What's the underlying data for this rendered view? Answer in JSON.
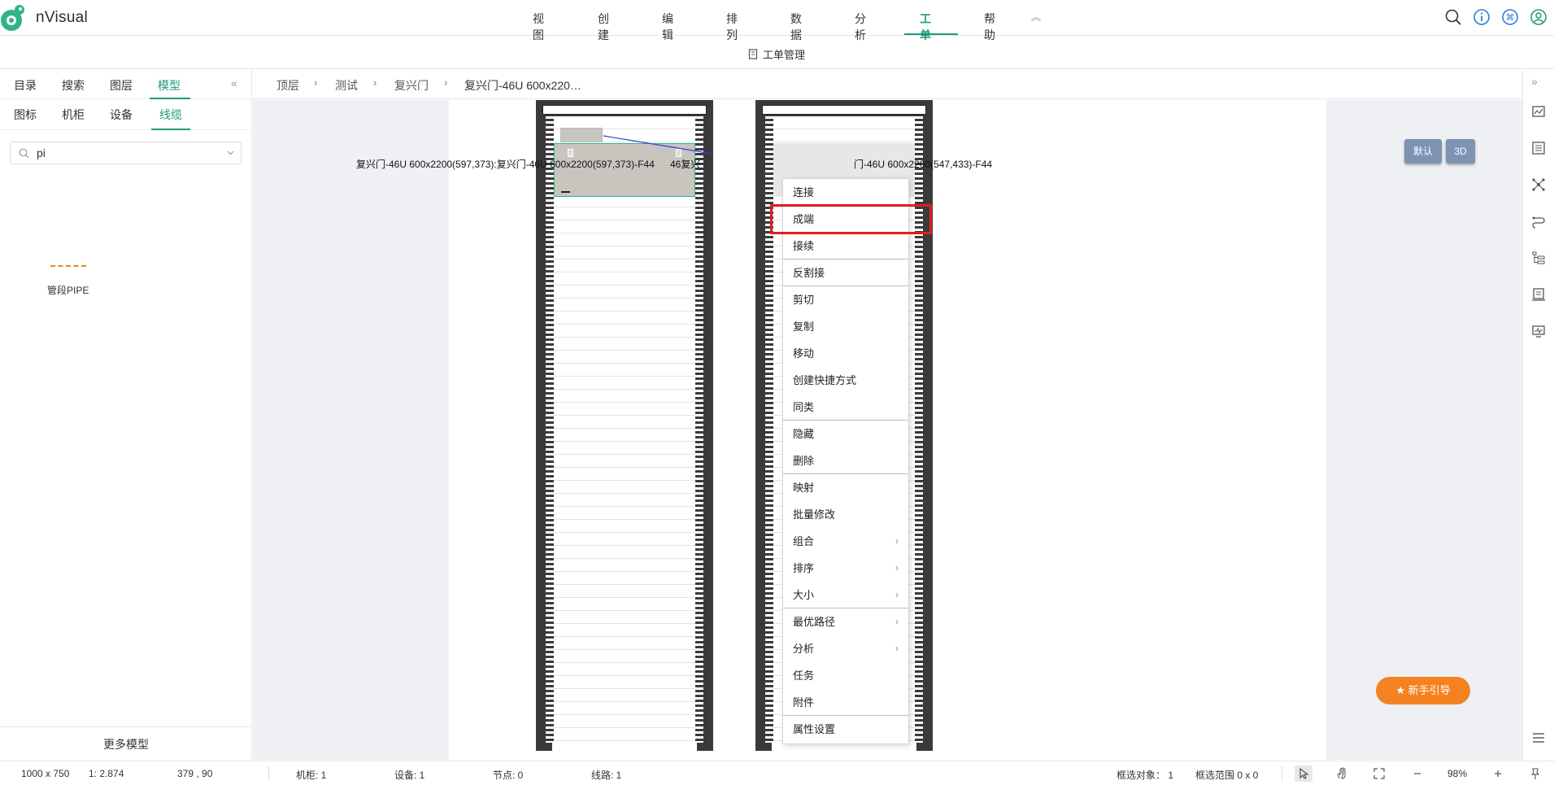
{
  "app": {
    "name": "nVisual"
  },
  "top_menu": {
    "items": [
      "视图",
      "创建",
      "编辑",
      "排列",
      "数据",
      "分析",
      "工单",
      "帮助"
    ],
    "active": "工单"
  },
  "sub_header": {
    "title": "工单管理"
  },
  "left_panel": {
    "tabs": [
      "目录",
      "搜索",
      "图层",
      "模型"
    ],
    "active_tab": "模型",
    "sub_tabs": [
      "图标",
      "机柜",
      "设备",
      "线缆"
    ],
    "active_sub_tab": "线缆",
    "search": {
      "value": "pi",
      "placeholder": ""
    },
    "models": [
      {
        "label": "管段PIPE",
        "line_color": "#e08e14"
      }
    ],
    "more_models_label": "更多模型"
  },
  "breadcrumb": [
    "顶层",
    "测试",
    "复兴门",
    "复兴门-46U 600x220…"
  ],
  "canvas": {
    "label_left": "复兴门-46U 600x2200(597,373):复兴门-46U 600x2200(597,373)-F44",
    "label_overlap": "46复兴",
    "label_right": "门-46U 600x2200(547,433)-F44",
    "view_buttons": [
      "默认",
      "3D"
    ],
    "guide_button": "新手引导"
  },
  "context_menu": {
    "items": [
      {
        "label": "连接"
      },
      {
        "label": "成端",
        "highlighted": true
      },
      {
        "label": "接续"
      },
      {
        "label": "反割接"
      },
      {
        "label": "剪切"
      },
      {
        "label": "复制"
      },
      {
        "label": "移动"
      },
      {
        "label": "创建快捷方式"
      },
      {
        "label": "同类"
      },
      {
        "label": "隐藏"
      },
      {
        "label": "删除"
      },
      {
        "label": "映射"
      },
      {
        "label": "批量修改"
      },
      {
        "label": "组合",
        "submenu": true
      },
      {
        "label": "排序",
        "submenu": true
      },
      {
        "label": "大小",
        "submenu": true
      },
      {
        "label": "最优路径",
        "submenu": true
      },
      {
        "label": "分析",
        "submenu": true
      },
      {
        "label": "任务"
      },
      {
        "label": "附件"
      },
      {
        "label": "属性设置"
      }
    ]
  },
  "status_bar": {
    "size": "1000 x 750",
    "scale": "1: 2.874",
    "coords": "379 , 90",
    "cabinets": "机柜: 1",
    "devices": "设备: 1",
    "nodes": "节点: 0",
    "links": "线路: 1",
    "selected": "框选对象： 1",
    "range": "框选范围  0 x 0",
    "zoom": "98%"
  },
  "colors": {
    "accent": "#1e9a7b",
    "highlight_box": "#e21f1f",
    "guide_button": "#f58220",
    "view_button": "#7d93b2"
  },
  "icons": {
    "top": [
      "search-icon",
      "info-icon",
      "command-icon",
      "user-icon"
    ],
    "right_rail": [
      "collapse-icon",
      "thumbnail-icon",
      "list-icon",
      "topology-icon",
      "route-icon",
      "tree-icon",
      "report-icon",
      "monitor-icon",
      "menu-icon"
    ],
    "status": [
      "cursor-icon",
      "hand-icon",
      "fullscreen-icon",
      "zoom-out-icon",
      "zoom-in-icon"
    ]
  }
}
